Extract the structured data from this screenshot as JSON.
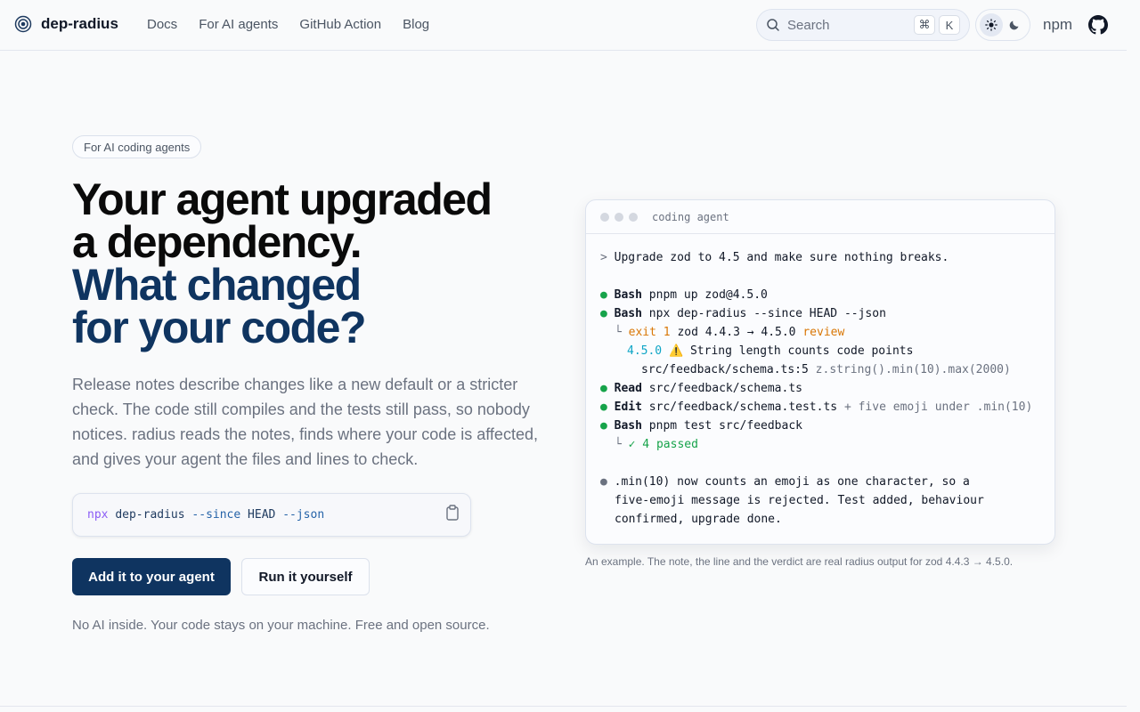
{
  "header": {
    "brand": "dep-radius",
    "nav": [
      "Docs",
      "For AI agents",
      "GitHub Action",
      "Blog"
    ],
    "search_placeholder": "Search",
    "search_keys": [
      "⌘",
      "K"
    ],
    "npm_label": "npm"
  },
  "hero": {
    "badge": "For AI coding agents",
    "headline_1": "Your agent upgraded",
    "headline_2": "a dependency.",
    "headline_3": "What changed",
    "headline_4": "for your code?",
    "lede": "Release notes describe changes like a new default or a stricter check. The code still compiles and the tests still pass, so nobody notices. radius reads the notes, finds where your code is affected, and gives your agent the files and lines to check.",
    "command": {
      "npx": "npx",
      "pkg": "dep-radius",
      "flag1": "--since",
      "arg1": "HEAD",
      "flag2": "--json"
    },
    "primary_button": "Add it to your agent",
    "secondary_button": "Run it yourself",
    "footnote": "No AI inside. Your code stays on your machine. Free and open source."
  },
  "terminal": {
    "title": "coding agent",
    "prompt": ">",
    "prompt_text": "Upgrade zod to 4.5 and make sure nothing breaks.",
    "bullet": "●",
    "branch": "└",
    "l1_cmd": "Bash",
    "l1_text": "pnpm up zod@4.5.0",
    "l2_cmd": "Bash",
    "l2_text": "npx dep-radius --since HEAD --json",
    "l3_exit": "exit 1",
    "l3_text": "zod 4.4.3 → 4.5.0",
    "l3_review": "review",
    "l4_ver": "4.5.0",
    "l4_text": "⚠️ String length counts code points",
    "l5_file": "src/feedback/schema.ts:5",
    "l5_code": "z.string().min(10).max(2000)",
    "l6_cmd": "Read",
    "l6_text": "src/feedback/schema.ts",
    "l7_cmd": "Edit",
    "l7_text": "src/feedback/schema.test.ts",
    "l7_note": "+ five emoji under .min(10)",
    "l8_cmd": "Bash",
    "l8_text": "pnpm test src/feedback",
    "l9_text": "✓ 4 passed",
    "summary_1": ".min(10) now counts an emoji as one character, so a",
    "summary_2": "five-emoji message is rejected. Test added, behaviour",
    "summary_3": "confirmed, upgrade done."
  },
  "caption": "An example. The note, the line and the verdict are real radius output for zod 4.4.3 → 4.5.0."
}
